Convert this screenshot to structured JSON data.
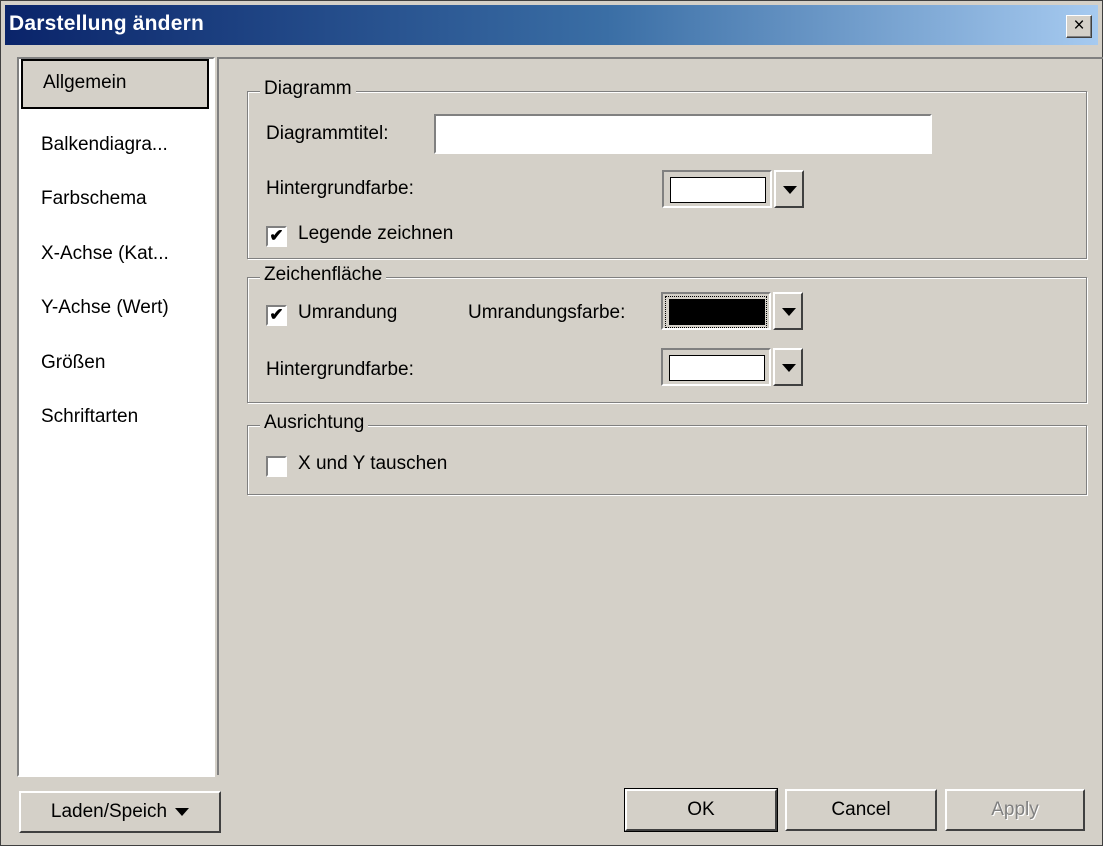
{
  "window": {
    "title": "Darstellung ändern",
    "close_label": "×"
  },
  "sidebar": {
    "items": [
      {
        "label": "Allgemein",
        "active": true
      },
      {
        "label": "Balkendiagra..."
      },
      {
        "label": "Farbschema"
      },
      {
        "label": "X-Achse (Kat..."
      },
      {
        "label": "Y-Achse (Wert)"
      },
      {
        "label": "Größen"
      },
      {
        "label": "Schriftarten"
      }
    ]
  },
  "diagramm": {
    "title": "Diagramm",
    "titel_label": "Diagrammtitel:",
    "titel_value": "",
    "bg_label": "Hintergrundfarbe:",
    "bg_color": "#ffffff",
    "legende_label": "Legende zeichnen",
    "legende_checked": true,
    "check_mark": "✔"
  },
  "zeichenflaeche": {
    "title": "Zeichenfläche",
    "umrandung_label": "Umrandung",
    "umrandung_checked": true,
    "check_mark": "✔",
    "umrandungsfarbe_label": "Umrandungsfarbe:",
    "umrandungsfarbe_color": "#000000",
    "bg_label": "Hintergrundfarbe:",
    "bg_color": "#ffffff"
  },
  "ausrichtung": {
    "title": "Ausrichtung",
    "tauschen_label": "X und Y tauschen",
    "tauschen_checked": false
  },
  "footer": {
    "laden_label": "Laden/Speich",
    "ok_label": "OK",
    "cancel_label": "Cancel",
    "apply_label": "Apply"
  }
}
